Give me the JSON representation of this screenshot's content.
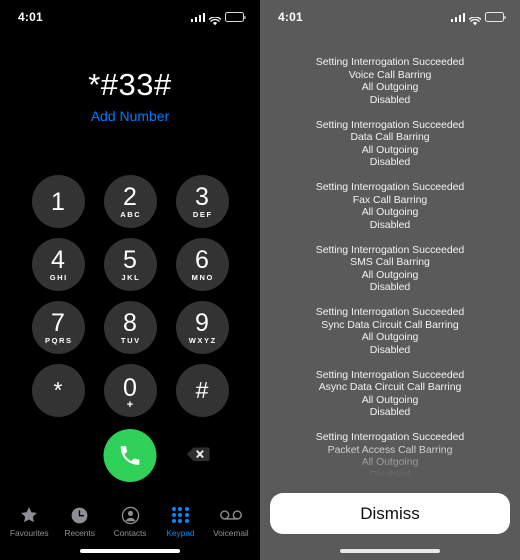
{
  "status_bar": {
    "time": "4:01",
    "signal_icon": "cellular-signal-icon",
    "wifi_icon": "wifi-icon",
    "battery_icon": "battery-icon"
  },
  "dialer": {
    "entered_number": "*#33#",
    "add_number_label": "Add Number",
    "keys": [
      {
        "digit": "1",
        "letters": ""
      },
      {
        "digit": "2",
        "letters": "ABC"
      },
      {
        "digit": "3",
        "letters": "DEF"
      },
      {
        "digit": "4",
        "letters": "GHI"
      },
      {
        "digit": "5",
        "letters": "JKL"
      },
      {
        "digit": "6",
        "letters": "MNO"
      },
      {
        "digit": "7",
        "letters": "PQRS"
      },
      {
        "digit": "8",
        "letters": "TUV"
      },
      {
        "digit": "9",
        "letters": "WXYZ"
      },
      {
        "digit": "*",
        "letters": ""
      },
      {
        "digit": "0",
        "letters": "+"
      },
      {
        "digit": "#",
        "letters": ""
      }
    ],
    "call_button_icon": "phone-handset-icon",
    "call_button_color": "#30d158",
    "delete_button_icon": "backspace-delete-icon"
  },
  "tab_bar": {
    "active": "Keypad",
    "active_color": "#0a84ff",
    "inactive_color": "#8e8e93",
    "items": [
      {
        "label": "Favourites",
        "icon": "star-icon"
      },
      {
        "label": "Recents",
        "icon": "clock-icon"
      },
      {
        "label": "Contacts",
        "icon": "person-circle-icon"
      },
      {
        "label": "Keypad",
        "icon": "keypad-grid-icon"
      },
      {
        "label": "Voicemail",
        "icon": "voicemail-icon"
      }
    ]
  },
  "alert": {
    "overlay_color": "#5a5a5a",
    "blocks": [
      {
        "lines": [
          "Setting Interrogation Succeeded",
          "Voice Call Barring",
          "All Outgoing",
          "Disabled"
        ]
      },
      {
        "lines": [
          "Setting Interrogation Succeeded",
          "Data Call Barring",
          "All Outgoing",
          "Disabled"
        ]
      },
      {
        "lines": [
          "Setting Interrogation Succeeded",
          "Fax Call Barring",
          "All Outgoing",
          "Disabled"
        ]
      },
      {
        "lines": [
          "Setting Interrogation Succeeded",
          "SMS Call Barring",
          "All Outgoing",
          "Disabled"
        ]
      },
      {
        "lines": [
          "Setting Interrogation Succeeded",
          "Sync Data Circuit Call Barring",
          "All Outgoing",
          "Disabled"
        ]
      },
      {
        "lines": [
          "Setting Interrogation Succeeded",
          "Async Data Circuit Call Barring",
          "All Outgoing",
          "Disabled"
        ]
      },
      {
        "lines": [
          "Setting Interrogation Succeeded",
          "Packet Access Call Barring",
          "All Outgoing",
          "Disabled"
        ]
      }
    ],
    "dismiss_label": "Dismiss"
  }
}
